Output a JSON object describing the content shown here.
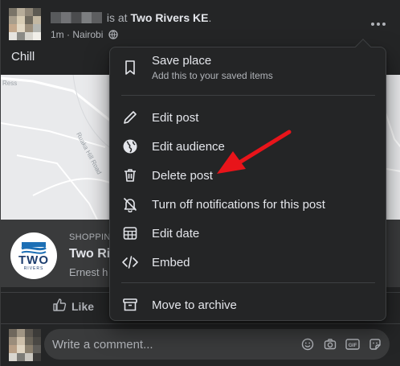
{
  "post": {
    "status_prefix": "is at",
    "place": "Two Rivers KE",
    "place_suffix": ".",
    "time": "1m",
    "separator": "·",
    "location": "Nairobi",
    "text": "Chill"
  },
  "map": {
    "road_label": "Ruaka Hill Road",
    "partial_label": "Ress"
  },
  "place_card": {
    "category": "SHOPPING",
    "title": "Two Ri",
    "subtitle": "Ernest h",
    "logo_text": "TWO",
    "logo_subtext": "RIVERS"
  },
  "actions": {
    "like_label": "Like"
  },
  "comment": {
    "placeholder": "Write a comment..."
  },
  "menu": {
    "items": [
      {
        "label": "Save place",
        "sub": "Add this to your saved items",
        "icon": "bookmark-icon"
      },
      {
        "label": "Edit post",
        "icon": "pencil-icon"
      },
      {
        "label": "Edit audience",
        "icon": "globe-icon"
      },
      {
        "label": "Delete post",
        "icon": "trash-icon"
      },
      {
        "label": "Turn off notifications for this post",
        "icon": "bell-off-icon"
      },
      {
        "label": "Edit date",
        "icon": "calendar-icon"
      },
      {
        "label": "Embed",
        "icon": "code-icon"
      },
      {
        "label": "Move to archive",
        "icon": "archive-icon"
      }
    ]
  },
  "colors": {
    "background": "#242526",
    "menu_bg": "#242526",
    "text": "#e4e6eb",
    "muted": "#b0b3b8",
    "annotation_arrow": "#e8141a"
  }
}
